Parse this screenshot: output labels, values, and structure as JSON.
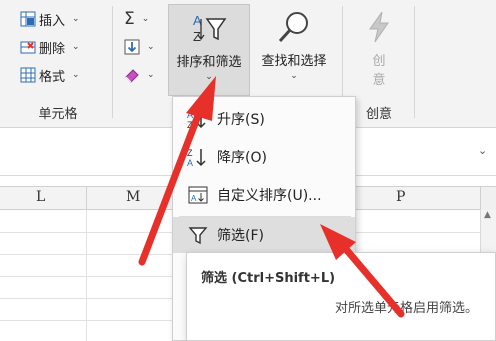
{
  "ribbon": {
    "cells_group": {
      "insert_label": "插入",
      "delete_label": "删除",
      "format_label": "格式",
      "group_label": "单元格"
    },
    "editing_group": {
      "sort_filter_label": "排序和筛选",
      "find_select_label": "查找和选择"
    },
    "creative_group": {
      "create_label_1": "创",
      "create_label_2": "意",
      "group_label": "创意"
    }
  },
  "columns": [
    "L",
    "M",
    "P"
  ],
  "menu": {
    "items": [
      {
        "icon": "sort-ascending-icon",
        "label": "升序(S)"
      },
      {
        "icon": "sort-descending-icon",
        "label": "降序(O)"
      },
      {
        "icon": "custom-sort-icon",
        "label": "自定义排序(U)..."
      },
      {
        "icon": "filter-funnel-icon",
        "label": "筛选(F)"
      }
    ]
  },
  "tooltip": {
    "title": "筛选 (Ctrl+Shift+L)",
    "description": "对所选单元格启用筛选。"
  },
  "colors": {
    "ribbon_bg": "#f3f3f3",
    "accent_blue": "#2b6cb5",
    "arrow_red": "#e8302a",
    "menu_highlight": "#dedede"
  }
}
